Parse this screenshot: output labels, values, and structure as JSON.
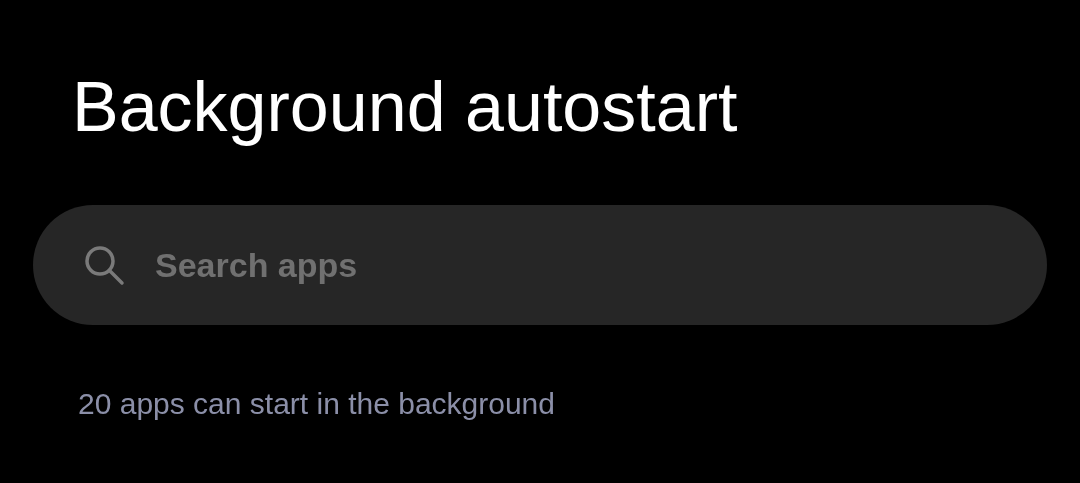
{
  "title": "Background autostart",
  "search": {
    "placeholder": "Search apps"
  },
  "summary": "20 apps can start in the background"
}
